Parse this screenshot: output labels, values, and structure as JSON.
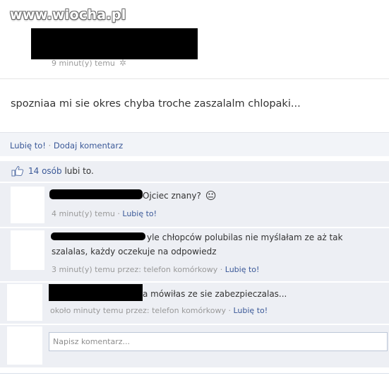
{
  "watermark": "www.wiocha.pl",
  "post": {
    "time": "9 minut(y) temu",
    "status": "spozniaa mi sie okres chyba troche zaszalalm chlopaki...",
    "like_action": "Lubię to!",
    "comment_action": "Dodaj komentarz",
    "separator": "·"
  },
  "likes": {
    "count": "14 osób",
    "suffix": "lubi to."
  },
  "comments": [
    {
      "text": "Ojciec znany?",
      "emoji": "😐",
      "meta": "4 minut(y) temu",
      "like": "Lubię to!"
    },
    {
      "text_line1": "yle chłopców polubilas nie myślałam ze aż tak",
      "text_line2": "szalalas, każdy oczekuje na odpowiedz",
      "meta": "3 minut(y) temu przez: telefon komórkowy",
      "like": "Lubię to!"
    },
    {
      "text": "a mówiłas ze sie zabezpieczalas...",
      "meta": "około minuty temu przez: telefon komórkowy",
      "like": "Lubię to!"
    }
  ],
  "composer": {
    "placeholder": "Napisz komentarz..."
  }
}
